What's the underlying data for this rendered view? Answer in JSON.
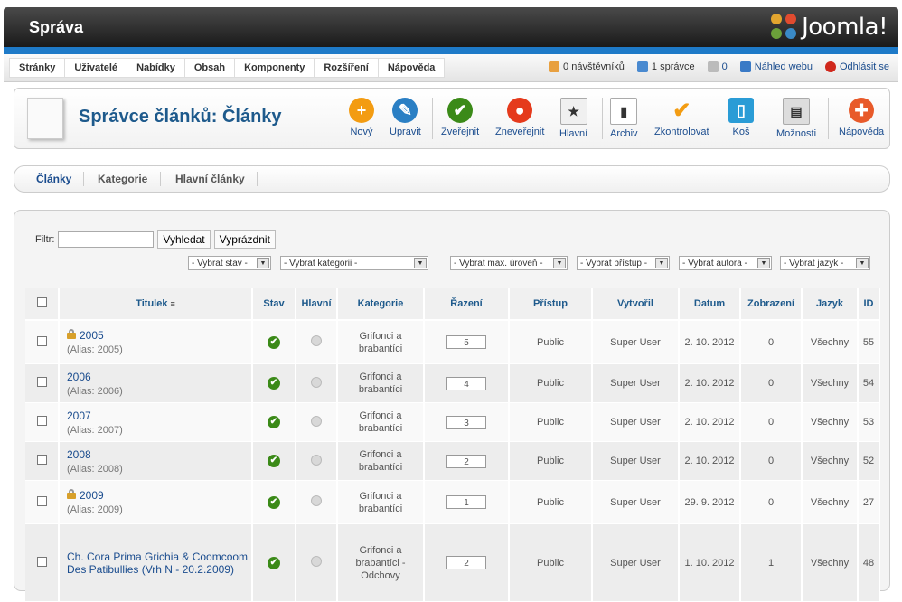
{
  "header": {
    "title": "Správa",
    "logo_text": "Joomla!"
  },
  "menu": [
    "Stránky",
    "Uživatelé",
    "Nabídky",
    "Obsah",
    "Komponenty",
    "Rozšíření",
    "Nápověda"
  ],
  "status": {
    "visitors": "0 návštěvníků",
    "admins": "1 správce",
    "messages": "0",
    "preview": "Náhled webu",
    "logout": "Odhlásit se"
  },
  "page": {
    "title": "Správce článků: Články"
  },
  "toolbar": [
    {
      "label": "Nový",
      "color": "#f39c12"
    },
    {
      "label": "Upravit",
      "color": "#2a7fc4"
    },
    {
      "label": "Zveřejnit",
      "color": "#3b8a18"
    },
    {
      "label": "Zneveřejnit",
      "color": "#e53a1c"
    },
    {
      "label": "Hlavní",
      "color": "#f0f0f0"
    },
    {
      "label": "Archiv",
      "color": "#ffffff"
    },
    {
      "label": "Zkontrolovat",
      "color": "#f39c12"
    },
    {
      "label": "Koš",
      "color": "#2a9cd6"
    },
    {
      "label": "Možnosti",
      "color": "#dddddd"
    },
    {
      "label": "Nápověda",
      "color": "#e85a2a"
    }
  ],
  "subtabs": [
    "Články",
    "Kategorie",
    "Hlavní články"
  ],
  "filter": {
    "label": "Filtr:",
    "value": "",
    "search_btn": "Vyhledat",
    "clear_btn": "Vyprázdnit"
  },
  "selects": [
    "- Vybrat stav -",
    "- Vybrat kategorii -",
    "- Vybrat max. úroveň -",
    "- Vybrat přístup -",
    "- Vybrat autora -",
    "- Vybrat jazyk -"
  ],
  "table": {
    "headers": [
      "Titulek",
      "Stav",
      "Hlavní",
      "Kategorie",
      "Řazení",
      "Přístup",
      "Vytvořil",
      "Datum",
      "Zobrazení",
      "Jazyk",
      "ID"
    ],
    "rows": [
      {
        "title": "2005",
        "alias": "(Alias: 2005)",
        "locked": true,
        "category": "Grifonci a brabantíci",
        "order": "5",
        "access": "Public",
        "author": "Super User",
        "date": "2. 10. 2012",
        "hits": "0",
        "lang": "Všechny",
        "id": "55"
      },
      {
        "title": "2006",
        "alias": "(Alias: 2006)",
        "locked": false,
        "category": "Grifonci a brabantíci",
        "order": "4",
        "access": "Public",
        "author": "Super User",
        "date": "2. 10. 2012",
        "hits": "0",
        "lang": "Všechny",
        "id": "54"
      },
      {
        "title": "2007",
        "alias": "(Alias: 2007)",
        "locked": false,
        "category": "Grifonci a brabantíci",
        "order": "3",
        "access": "Public",
        "author": "Super User",
        "date": "2. 10. 2012",
        "hits": "0",
        "lang": "Všechny",
        "id": "53"
      },
      {
        "title": "2008",
        "alias": "(Alias: 2008)",
        "locked": false,
        "category": "Grifonci a brabantíci",
        "order": "2",
        "access": "Public",
        "author": "Super User",
        "date": "2. 10. 2012",
        "hits": "0",
        "lang": "Všechny",
        "id": "52"
      },
      {
        "title": "2009",
        "alias": "(Alias: 2009)",
        "locked": true,
        "category": "Grifonci a brabantíci",
        "order": "1",
        "access": "Public",
        "author": "Super User",
        "date": "29. 9. 2012",
        "hits": "0",
        "lang": "Všechny",
        "id": "27"
      },
      {
        "title": "Ch. Cora Prima Grichia & Coomcoom Des Patibullies (Vrh N - 20.2.2009)",
        "alias": "",
        "locked": false,
        "category": "Grifonci a brabantíci - Odchovy",
        "order": "2",
        "access": "Public",
        "author": "Super User",
        "date": "1. 10. 2012",
        "hits": "1",
        "lang": "Všechny",
        "id": "48"
      }
    ]
  }
}
